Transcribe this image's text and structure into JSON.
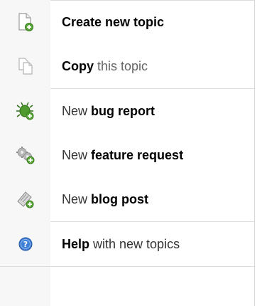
{
  "menu": {
    "items": [
      {
        "icon": "new-page-icon",
        "bold": "Create new topic",
        "rest": ""
      },
      {
        "icon": "copy-pages-icon",
        "bold": "Copy",
        "rest": " this topic"
      },
      {
        "icon": "bug-icon",
        "pre": "New ",
        "bold": "bug report"
      },
      {
        "icon": "gear-icon",
        "pre": "New ",
        "bold": "feature request"
      },
      {
        "icon": "blog-post-icon",
        "pre": "New ",
        "bold": "blog post"
      },
      {
        "icon": "help-icon",
        "bold": "Help",
        "rest": " with new topics"
      }
    ]
  },
  "colors": {
    "gutter": "#f7f7f7",
    "separator": "#dcdcdc",
    "add_badge": "#5aa83a",
    "bug": "#4f9a2e",
    "help": "#3d7fd6"
  }
}
